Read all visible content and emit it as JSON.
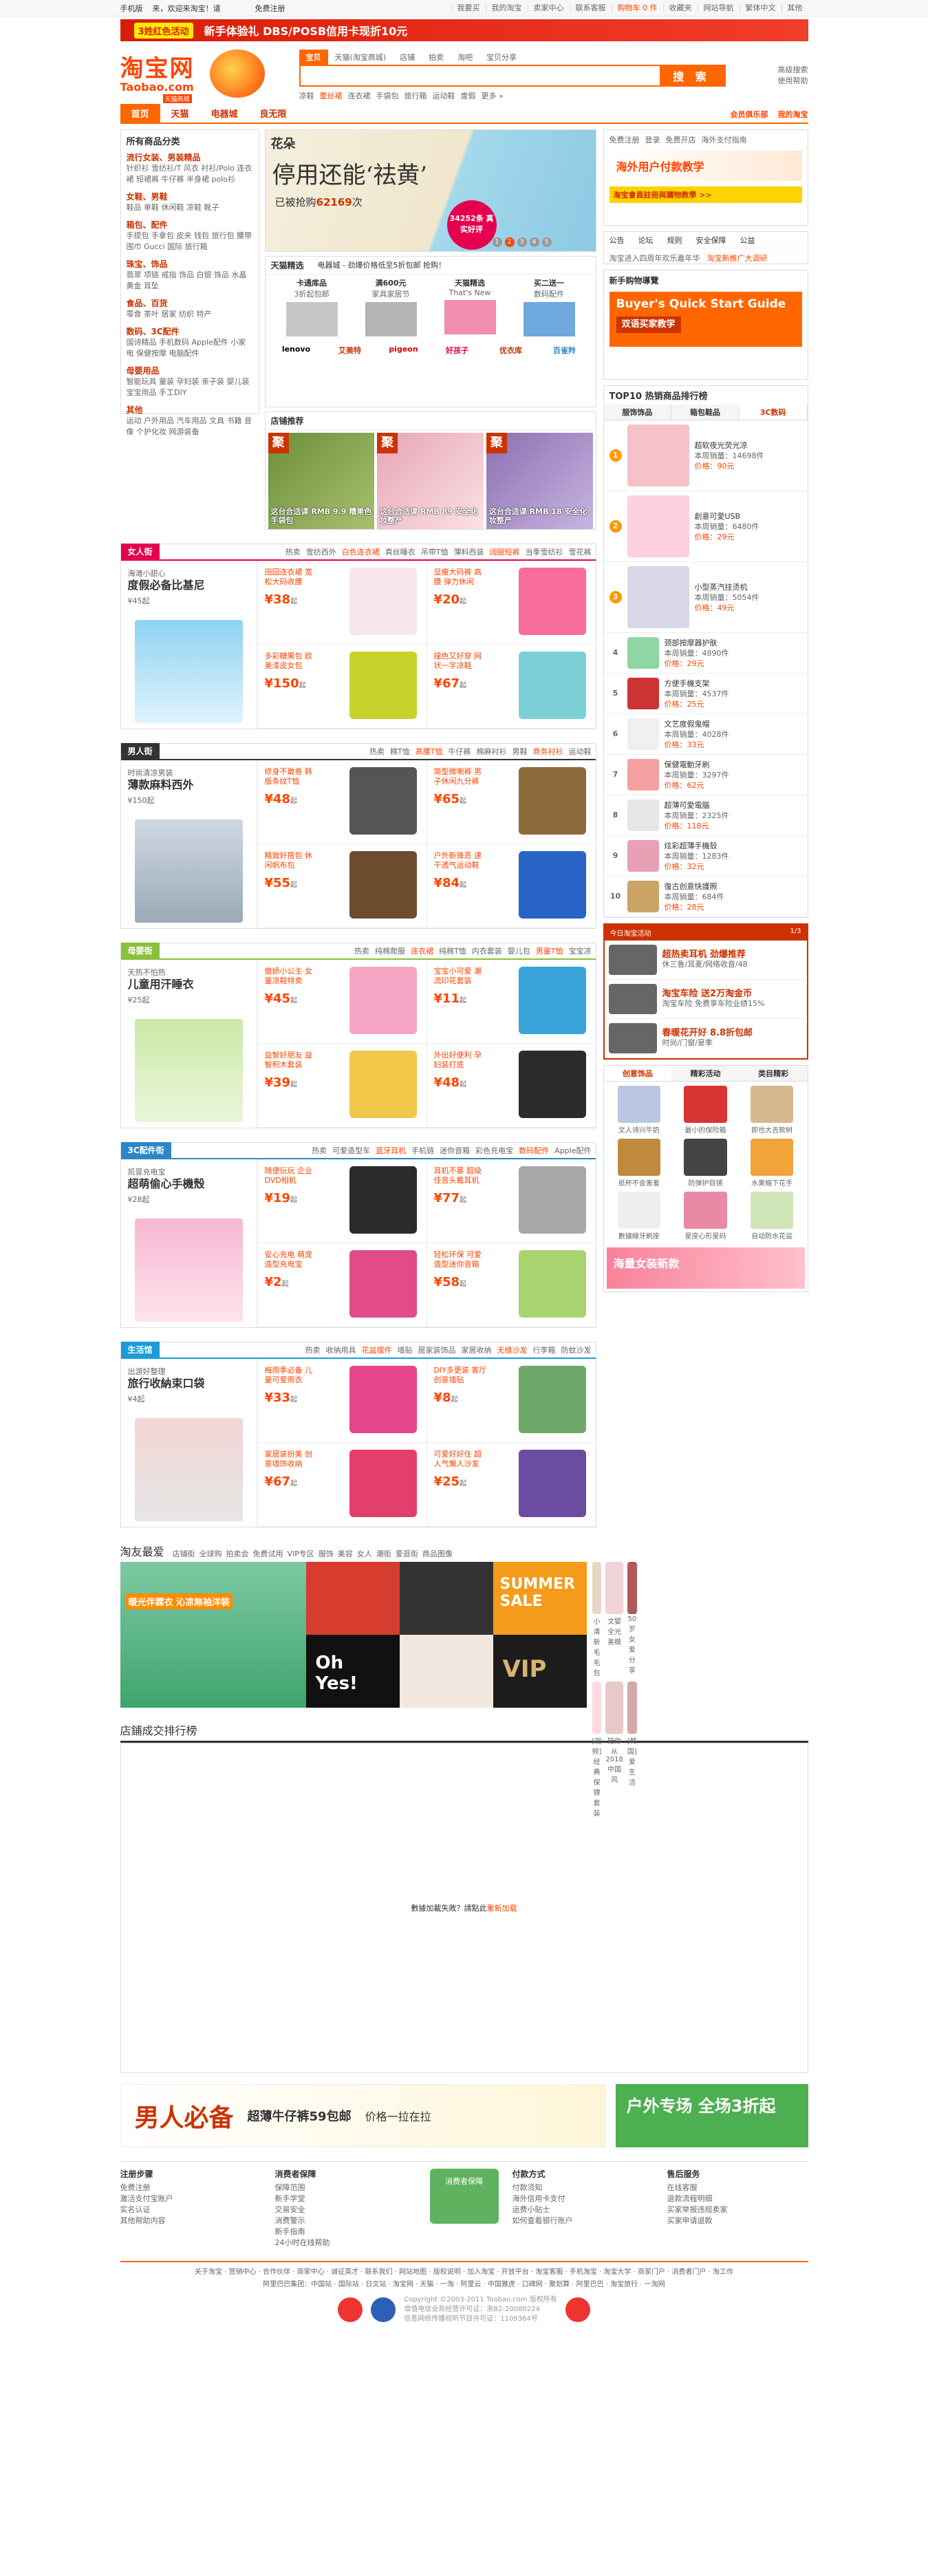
{
  "topbar": {
    "mobile": "手机版",
    "welcome": "来，欢迎来淘宝！请",
    "login": "登录",
    "register": "免费注册",
    "links": [
      "我要买",
      "我的淘宝",
      "卖家中心",
      "联系客服",
      "购物车 0 件",
      "收藏夹",
      "网站导航",
      "繁体中文",
      "其他"
    ]
  },
  "banner_top": {
    "tag": "3姓红色活动",
    "text": "新手体验礼 DBS/POSB信用卡现折10元"
  },
  "logo": {
    "cn": "淘宝网",
    "en": "Taobao.com"
  },
  "search": {
    "tabs": [
      "宝贝",
      "天猫(淘宝商城)",
      "店铺",
      "拍卖",
      "淘吧",
      "宝贝分享"
    ],
    "placeholder": "",
    "button": "搜 索",
    "hot": [
      "凉鞋",
      "蕾丝裙",
      "连衣裙",
      "手袋包",
      "旅行箱",
      "运动鞋",
      "度假",
      "更多 »"
    ],
    "side": [
      "高级搜索",
      "使用帮助"
    ]
  },
  "nav": {
    "items": [
      "首页",
      "天猫",
      "电器城",
      "良无限"
    ],
    "badge": "天猫商城",
    "right": [
      "会员俱乐部",
      "我的淘宝"
    ]
  },
  "cats": {
    "title": "所有商品分类",
    "groups": [
      {
        "t": "流行女装、男装精品",
        "l": "针织衫 雪纺衫/T 风衣 衬衫/Polo 连衣裙 短裙裤 牛仔裤 半身裙 polo衫"
      },
      {
        "t": "女鞋、男鞋",
        "l": "鞋品 单鞋 休闲鞋 凉鞋 靴子"
      },
      {
        "t": "箱包、配件",
        "l": "手提包 手拿包 皮夹 钱包 旅行包 腰带 围巾 Gucci 国际 旅行箱"
      },
      {
        "t": "珠宝、饰品",
        "l": "翡翠 项链 戒指 饰品 白银 饰品 水晶 黄金 耳坠"
      },
      {
        "t": "食品、百货",
        "l": "零食 茶叶 居家 纺织 特产"
      },
      {
        "t": "数码、3C配件",
        "l": "国诗精品 手机数码 Apple配件 小家电 保健按摩 电脑配件"
      },
      {
        "t": "母婴用品",
        "l": "智能玩具 童装 孕妇装 亲子装 婴儿装 宝宝用品 手工DIY"
      },
      {
        "t": "其他",
        "l": "运动 户外用品 汽车用品 文具 书籍 音像 个护化妆 网游装备"
      }
    ]
  },
  "slide": {
    "brand": "花朵",
    "t1": "停用还能‘祛黄’",
    "t2": "已被抢购",
    "t2_num": "62169",
    "t2_unit": "次",
    "bubble": "34252条 真实好评",
    "dots": [
      "1",
      "2",
      "3",
      "4",
      "5"
    ]
  },
  "hotbox": {
    "header": [
      "天猫精选",
      "电器城 - 劲爆价格低至5折包邮 抢购！"
    ],
    "prods": [
      {
        "n": "卡通库品",
        "d": "3折起包邮"
      },
      {
        "n": "满600元",
        "d": "家具家居节"
      },
      {
        "n": "天猫精选",
        "d": "That's New"
      },
      {
        "n": "买二送一",
        "d": "数码配件"
      }
    ],
    "logos": [
      "lenovo",
      "艾美特",
      "pigeon",
      "好孩子",
      "优衣库",
      "百雀羚"
    ]
  },
  "shopRec": {
    "title": "店铺推荐",
    "shops": [
      {
        "ju": "聚",
        "cap": "这台合适课 RMB 9.9 糟果色手袋包"
      },
      {
        "ju": "聚",
        "cap": "这台合适课 RMB 89 安全化妆整产"
      },
      {
        "ju": "聚",
        "cap": "这台合适课 RMB 18 安全化妆整产"
      }
    ]
  },
  "floors": [
    {
      "name": "女人街",
      "color": "#e5004f",
      "kws": [
        "热卖",
        "雪纺西外",
        "白色连衣裙",
        "真丝睡衣",
        "吊带T恤",
        "薄料西装",
        "阔腿短裤",
        "当季雪纺衫",
        "雪花裤"
      ],
      "big": {
        "s": "海滩小甜心",
        "t": "度假必备比基尼",
        "pr": "¥45起"
      },
      "cells": [
        {
          "d": "田园连衣裙 宽松大码收腰",
          "pr": "¥38",
          "u": "起"
        },
        {
          "d": "显瘦大码裤 高腰 弹力休闲",
          "pr": "¥20",
          "u": "起"
        },
        {
          "d": "多彩糖果包 欧美漆皮女包",
          "pr": "¥150",
          "u": "起"
        },
        {
          "d": "撞色又好穿 网状一字凉鞋",
          "pr": "¥67",
          "u": "起"
        }
      ]
    },
    {
      "name": "男人街",
      "color": "#333333",
      "kws": [
        "热卖",
        "棉T恤",
        "高腰T恤",
        "牛仔裤",
        "棉麻衬衫",
        "男鞋",
        "商务衬衫",
        "运动鞋"
      ],
      "big": {
        "s": "时尚清凉男装",
        "t": "薄款麻料西外",
        "pr": "¥150起"
      },
      "cells": [
        {
          "d": "修身不敢卷 韩版条纹T恤",
          "pr": "¥48",
          "u": "起"
        },
        {
          "d": "简型微喇裤 男子休闲九分裤",
          "pr": "¥65",
          "u": "起"
        },
        {
          "d": "精致好搭包 休闲帆布包",
          "pr": "¥55",
          "u": "起"
        },
        {
          "d": "户外新锋恶 速干透气运动鞋",
          "pr": "¥84",
          "u": "起"
        }
      ]
    },
    {
      "name": "母婴街",
      "color": "#89c13b",
      "kws": [
        "热卖",
        "纯棉爬服",
        "连衣裙",
        "纯棉T恤",
        "内衣套装",
        "婴儿包",
        "男童T恤",
        "宝宝凉"
      ],
      "big": {
        "s": "天热不怕热",
        "t": "儿童用汗睡衣",
        "pr": "¥25起"
      },
      "cells": [
        {
          "d": "傲娇小公主 女童凉鞋特卖",
          "pr": "¥45",
          "u": "起"
        },
        {
          "d": "宝宝小可爱 潮流印花套装",
          "pr": "¥11",
          "u": "起"
        },
        {
          "d": "益智好朋友 益智积木套装",
          "pr": "¥39",
          "u": "起"
        },
        {
          "d": "外出好便利 孕妇装打底",
          "pr": "¥48",
          "u": "起"
        }
      ]
    },
    {
      "name": "3C配件街",
      "color": "#2b87c7",
      "kws": [
        "热卖",
        "可爱造型车",
        "蓝牙耳机",
        "手机链",
        "迷你音箱",
        "彩色充电宝",
        "数码配件",
        "Apple配件"
      ],
      "big": {
        "s": "凯冒充电宝",
        "t": "超萌偷心手機殼",
        "pr": "¥28起"
      },
      "cells": [
        {
          "d": "随便玩玩 企业DVD相机",
          "pr": "¥19",
          "u": "起"
        },
        {
          "d": "耳机不暴 超级佳音头戴耳机",
          "pr": "¥77",
          "u": "起"
        },
        {
          "d": "安心充电 萌宠造型充电宝",
          "pr": "¥2",
          "u": "起"
        },
        {
          "d": "轻松环保 可爱造型迷你音箱",
          "pr": "¥58",
          "u": "起"
        }
      ]
    },
    {
      "name": "生活馆",
      "color": "#1a9cd8",
      "kws": [
        "热卖",
        "收纳用具",
        "花盆摆件",
        "墙贴",
        "居家装饰品",
        "家居收纳",
        "无缝沙发",
        "行李箱",
        "防蚊沙发"
      ],
      "big": {
        "s": "出游好整理",
        "t": "旅行收納束口袋",
        "pr": "¥4起"
      },
      "cells": [
        {
          "d": "梅雨季必备 儿童可爱雨衣",
          "pr": "¥33",
          "u": "起"
        },
        {
          "d": "DIY多更装 客厅创意墙贴",
          "pr": "¥8",
          "u": "起"
        },
        {
          "d": "家居装扮美 创意墙饰收纳",
          "pr": "¥67",
          "u": "起"
        },
        {
          "d": "可爱好好住 超人气懒人沙发",
          "pr": "¥25",
          "u": "起"
        }
      ]
    }
  ],
  "right": {
    "login_links": [
      "免费注册",
      "登录",
      "免费开店",
      "海外支付指南"
    ],
    "safe": "海外用户付款教学",
    "notice": "淘宝會員註冊與購物教學 >>",
    "news_tabs": [
      "公告",
      "论坛",
      "规则",
      "安全保障",
      "公益"
    ],
    "news": [
      "淘宝进入四周年欢乐嘉年华",
      "淘宝新推广大调研"
    ],
    "newbie_title": "新手购物導覽",
    "guide_t": "Buyer's Quick Start Guide",
    "guide_sub": "双语买家教学",
    "top10_title": "TOP10 热销商品排行榜",
    "top10_tabs": [
      "服饰饰品",
      "箱包鞋品",
      "3C数码"
    ],
    "ranks": [
      {
        "no": "1",
        "pn": "超软夜光荧光凉",
        "s": "本周销量：14698件",
        "p": "价格：90元"
      },
      {
        "no": "2",
        "pn": "創意可愛USB",
        "s": "本周销量：6480件",
        "p": "价格：29元"
      },
      {
        "no": "3",
        "pn": "小型蒸汽挂烫机",
        "s": "本周销量：5054件",
        "p": "价格：49元"
      },
      {
        "no": "4",
        "pn": "颈部按摩器护肤",
        "s": "本周销量：4890件",
        "p": "价格：29元"
      },
      {
        "no": "5",
        "pn": "方便手機支架",
        "s": "本周销量：4537件",
        "p": "价格：25元"
      },
      {
        "no": "6",
        "pn": "文艺度假鬼帽",
        "s": "本周销量：4028件",
        "p": "价格：33元"
      },
      {
        "no": "7",
        "pn": "保健電動牙刷",
        "s": "本周销量：3297件",
        "p": "价格：62元"
      },
      {
        "no": "8",
        "pn": "超薄可愛電腦",
        "s": "本周销量：2325件",
        "p": "价格：118元"
      },
      {
        "no": "9",
        "pn": "炫彩超薄手機殼",
        "s": "本周销量：1283件",
        "p": "价格：32元"
      },
      {
        "no": "10",
        "pn": "復古创意快護照",
        "s": "本周销量：684件",
        "p": "价格：28元"
      }
    ],
    "act_title": "今日淘宝活动",
    "act_page": "1/3",
    "acts": [
      {
        "b": "超热卖耳机 劲爆推荐",
        "t": "休三鲁/耳麦/网络收音/48"
      },
      {
        "b": "淘宝车险 送2万淘金币",
        "t": "淘宝车险 免费享车险业绩15%"
      },
      {
        "b": "春暖花开好 8.8折包邮",
        "t": "时尚/门窗/夏季"
      }
    ],
    "cre_tabs": [
      "创意饰品",
      "精彩活动",
      "类目精彩"
    ],
    "cre": [
      "文人诗兴牛奶",
      "最小的保险箱",
      "即也大吉款树",
      "纸杯不会害羞",
      "防弹护目镜",
      "水果缩下花手",
      "數據線牙刷座",
      "星座心形星码",
      "自动防水花盆"
    ],
    "cre_foot": "海量女装新款"
  },
  "taoyou": {
    "title": "淘友最爱",
    "links": [
      "店铺街",
      "全球购",
      "拍卖会",
      "免费试用",
      "VIP专区",
      "服饰",
      "美容",
      "女人",
      "潮街",
      "爱逛街",
      "商品图像"
    ],
    "m1": "暖光伴霖衣 沁凉無袖洋裝",
    "ft": [
      "小清新毛毛包",
      "文婴全光美模",
      "50岁女爱分享",
      "[视频]经典保镖套装",
      "陪你从2018中国风",
      "[韩国]爱生活"
    ]
  },
  "rankpanel": {
    "title": "店鋪成交排行榜",
    "msg": "數據加載失敗？請點此",
    "retry": "重新加载"
  },
  "promo": {
    "big": "男人必备",
    "mid": "超薄牛仔裤59包邮",
    "sm": "价格一拉在拉",
    "p2": "户外专场 全场3折起"
  },
  "footer": {
    "cols": [
      {
        "h": "注册步骤",
        "l": [
          "免费注册",
          "激活支付宝账户",
          "实名认证",
          "其他帮助内容"
        ]
      },
      {
        "h": "消费者保障",
        "l": [
          "保障范围",
          "新手学堂",
          "交易安全",
          "消费警示",
          "新手指南",
          "24小时在线帮助"
        ]
      },
      {
        "h": "付款方式",
        "l": [
          "付款须知",
          "海外信用卡支付",
          "运费小贴士",
          "如何查看银行账户"
        ]
      },
      {
        "h": "售后服务",
        "l": [
          "在线客服",
          "退款流程明细",
          "买家举报违规卖家",
          "买家申请退款"
        ]
      }
    ],
    "mid": "消费者保障",
    "nav1": "关于淘宝 · 营销中心 · 合作伙伴 · 商家中心 · 诚征英才 · 联系我们 · 网站地图 · 版权说明 · 加入淘宝 · 开放平台 · 淘宝客服 · 手机淘宝 · 淘宝大学 · 商家门户 · 消费者门户 · 淘工作",
    "nav2": "阿里巴巴集团：中国站 · 国际站 · 日文站 · 淘宝网 · 天猫 · 一淘 · 阿里云 · 中国雅虎 · 口碑网 · 聚划算 · 阿里巴巴 · 淘宝旅行 · 一淘网",
    "cp": [
      "Copyright ©2003-2011 Taobao.com 版权所有",
      "增值电信业务经营许可证：浙B2-20080224",
      "信息网络传播视听节目许可证：1109364号"
    ]
  }
}
